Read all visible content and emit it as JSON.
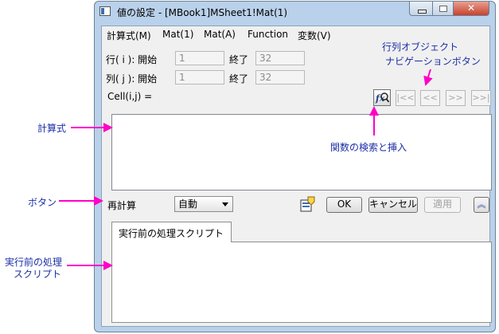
{
  "window": {
    "title": "値の設定 - [MBook1]MSheet1!Mat(1)",
    "close_glyph": "✕"
  },
  "menu": [
    "計算式(M)",
    "Mat(1)",
    "Mat(A)",
    "Function",
    "変数(V)"
  ],
  "rows": {
    "row_label": "行( i ): 開始",
    "row_start": "1",
    "row_end_label": "終了",
    "row_end": "32",
    "col_label": "列( j ): 開始",
    "col_start": "1",
    "col_end_label": "終了",
    "col_end": "32"
  },
  "cell_label": "Cell(i,j) =",
  "nav_buttons": [
    "|<<",
    "<<",
    ">>",
    ">>|"
  ],
  "recalc": {
    "label": "再計算",
    "selected": "自動"
  },
  "buttons": {
    "ok": "OK",
    "cancel": "キャンセル",
    "apply": "適用",
    "expand": "︽"
  },
  "tab": {
    "label": "実行前の処理スクリプト"
  },
  "annotations": {
    "nav": "行列オブジェクト\nナビゲーションボタン",
    "nav_line1": "行列オブジェクト",
    "nav_line2": "ナビゲーションボタン",
    "formula": "計算式",
    "find": "関数の検索と挿入",
    "button": "ボタン",
    "script_line1": "実行前の処理",
    "script_line2": "スクリプト"
  },
  "colors": {
    "arrow": "#ff00c8",
    "annotation_text": "#1a2ea6"
  }
}
